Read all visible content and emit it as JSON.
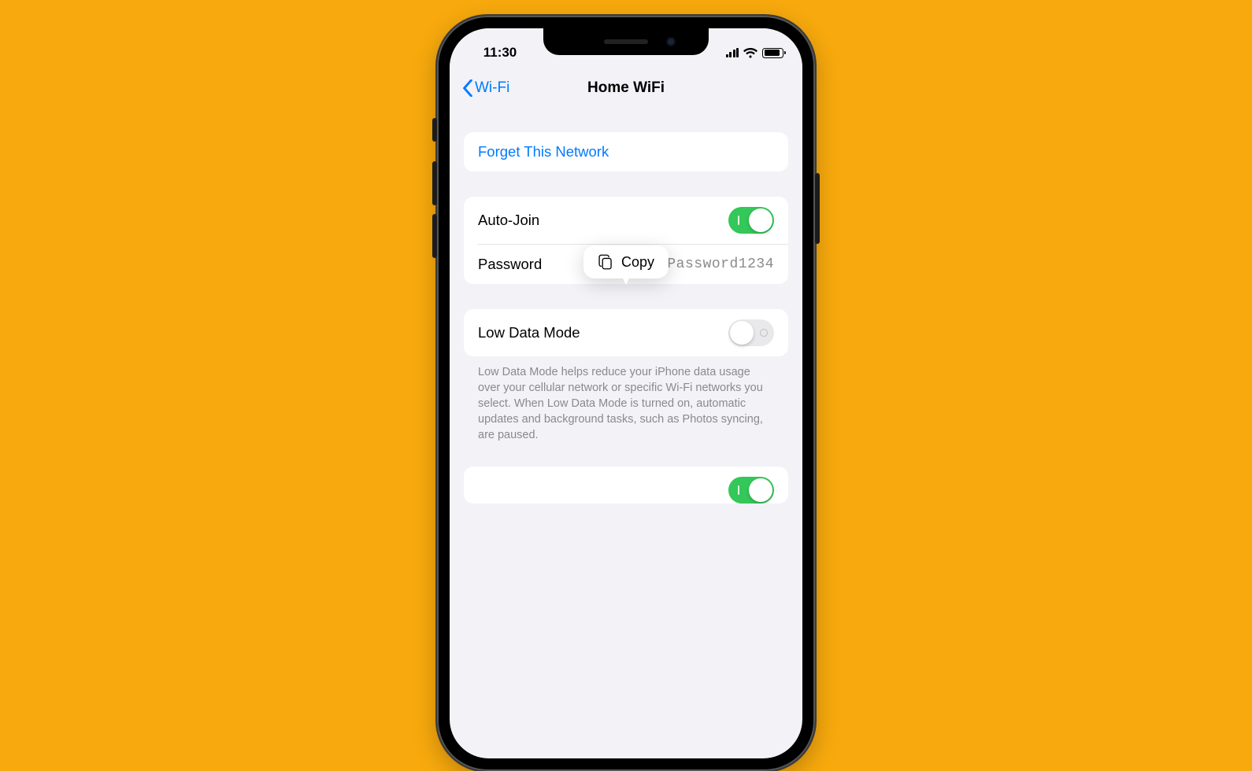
{
  "status": {
    "time": "11:30"
  },
  "nav": {
    "back_label": "Wi-Fi",
    "title": "Home WiFi"
  },
  "popover": {
    "copy_label": "Copy"
  },
  "actions": {
    "forget": "Forget This Network"
  },
  "settings": {
    "auto_join_label": "Auto-Join",
    "password_label": "Password",
    "password_value": "Password1234",
    "low_data_label": "Low Data Mode",
    "low_data_note": "Low Data Mode helps reduce your iPhone data usage over your cellular network or specific Wi-Fi networks you select. When Low Data Mode is turned on, automatic updates and background tasks, such as Photos syncing, are paused."
  }
}
